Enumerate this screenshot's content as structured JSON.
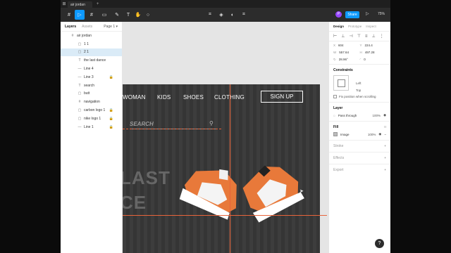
{
  "titlebar": {
    "logo": "⊞",
    "tab": "air jordan",
    "plus": "+"
  },
  "toolbar": {
    "tools": [
      "#",
      "▷",
      "▭",
      "✎",
      "T",
      "✋",
      "○"
    ],
    "center_tools": [
      "⌗",
      "◈",
      "◐",
      "⌗"
    ],
    "avatar": "P",
    "share": "Share",
    "play": "▷",
    "zoom": "75%"
  },
  "left_panel": {
    "tabs": [
      "Layers",
      "Assets"
    ],
    "page": "Page 1 ▾",
    "layers": [
      {
        "name": "air jordan",
        "icon": "#",
        "lock": false
      },
      {
        "name": "1 1",
        "icon": "▢",
        "lock": false
      },
      {
        "name": "2 1",
        "icon": "▢",
        "lock": false,
        "selected": true
      },
      {
        "name": "the last dance",
        "icon": "T",
        "lock": false
      },
      {
        "name": "Line 4",
        "icon": "—",
        "lock": false
      },
      {
        "name": "Line 3",
        "icon": "—",
        "lock": true
      },
      {
        "name": "search",
        "icon": "T",
        "lock": false
      },
      {
        "name": "butt",
        "icon": "▢",
        "lock": false
      },
      {
        "name": "navigation",
        "icon": "#",
        "lock": false
      },
      {
        "name": "carbon logo 1",
        "icon": "▢",
        "lock": true
      },
      {
        "name": "nike logo 1",
        "icon": "▢",
        "lock": true
      },
      {
        "name": "Line 1",
        "icon": "—",
        "lock": true
      }
    ]
  },
  "canvas": {
    "nav": [
      "WOMAN",
      "KIDS",
      "SHOES",
      "CLOTHING"
    ],
    "signup": "SIGN UP",
    "search": "SEARCH",
    "big_text_1": "LAST",
    "big_text_2": "CE"
  },
  "right_panel": {
    "tabs": [
      "Design",
      "Prototype",
      "Inspect"
    ],
    "props": {
      "x": "604",
      "y": "224.4",
      "w": "557.64",
      "h": "497.28",
      "rot": "28.96°",
      "radius": "0"
    },
    "constraints": {
      "title": "Constraints",
      "left": "Left",
      "top": "Top",
      "fix": "Fix position when scrolling"
    },
    "layer": {
      "title": "Layer",
      "mode": "Pass through",
      "opacity": "100%"
    },
    "fill": {
      "title": "Fill",
      "type": "Image",
      "opacity": "100%"
    },
    "stroke": "Stroke",
    "effects": "Effects",
    "export": "Export"
  },
  "help": "?"
}
